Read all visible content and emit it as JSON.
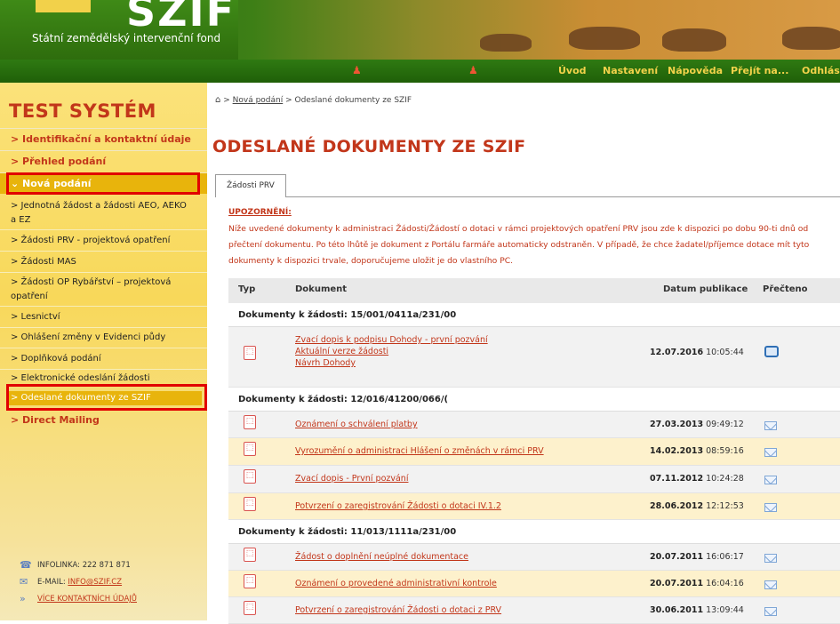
{
  "header": {
    "logo_text": "SZIF",
    "subtitle": "Státní zemědělský intervenční fond"
  },
  "nav": {
    "items": [
      "Úvod",
      "Nastavení",
      "Nápověda",
      "Přejít na...",
      "Odhlásit"
    ]
  },
  "sidebar": {
    "title": "TEST SYSTÉM",
    "main_items": [
      "> Identifikační a kontaktní údaje",
      "> Přehled podání",
      "⌄ Nová podání",
      "> Direct Mailing"
    ],
    "sub_items": [
      "> Jednotná žádost a žádosti AEO, AEKO a EZ",
      "> Žádosti PRV - projektová opatření",
      "> Žádosti MAS",
      "> Žádosti OP Rybářství – projektová opatření",
      "> Lesnictví",
      "> Ohlášení změny v Evidenci půdy",
      "> Doplňková podání",
      "> Elektronické odeslání žádosti",
      "> Odeslané dokumenty ze SZIF"
    ],
    "contact": {
      "phone": "INFOLINKA: 222 871 871",
      "email_label": "E-MAIL: ",
      "email": "INFO@SZIF.CZ",
      "more": "VÍCE KONTAKTNÍCH ÚDAJŮ"
    }
  },
  "breadcrumb": {
    "link": "Nová podání",
    "separator": " > ",
    "current": "Odeslané dokumenty ze SZIF"
  },
  "page_title": "ODESLANÉ DOKUMENTY ZE SZIF",
  "tab": "Žádosti PRV",
  "notice": {
    "title": "UPOZORNĚNÍ:",
    "text": "Níže uvedené dokumenty k administraci Žádosti/Žádostí o dotaci v rámci projektových opatření PRV jsou zde k dispozici po dobu 90-ti dnů od přečtení dokumentu. Po této lhůtě je dokument z Portálu farmáře automaticky odstraněn. V případě, že chce žadatel/příjemce dotace mít tyto dokumenty k dispozici trvale, doporučujeme uložit je do vlastního PC."
  },
  "table": {
    "headers": [
      "Typ",
      "Dokument",
      "Datum publikace",
      "Přečteno"
    ],
    "groups": [
      {
        "label": "Dokumenty k žádosti: 15/001/0411a/231/00",
        "rows": [
          {
            "docs": [
              "Zvací dopis k podpisu Dohody - první pozvání",
              "Aktuální verze žádosti",
              "Návrh Dohody"
            ],
            "date": "12.07.2016",
            "time": "10:05:44",
            "read": true
          }
        ]
      },
      {
        "label": "Dokumenty k žádosti: 12/016/41200/066/(",
        "rows": [
          {
            "docs": [
              "Oznámení o schválení platby"
            ],
            "date": "27.03.2013",
            "time": "09:49:12",
            "read": false
          },
          {
            "docs": [
              "Vyrozumění o administraci Hlášení o změnách v rámci PRV"
            ],
            "date": "14.02.2013",
            "time": "08:59:16",
            "read": false
          },
          {
            "docs": [
              "Zvací dopis - První pozvání"
            ],
            "date": "07.11.2012",
            "time": "10:24:28",
            "read": false
          },
          {
            "docs": [
              "Potvrzení o zaregistrování Žádosti o dotaci IV.1.2"
            ],
            "date": "28.06.2012",
            "time": "12:12:53",
            "read": false
          }
        ]
      },
      {
        "label": "Dokumenty k žádosti: 11/013/1111a/231/00",
        "rows": [
          {
            "docs": [
              "Žádost o doplnění neúplné dokumentace"
            ],
            "date": "20.07.2011",
            "time": "16:06:17",
            "read": false
          },
          {
            "docs": [
              "Oznámení o provedené administrativní kontrole"
            ],
            "date": "20.07.2011",
            "time": "16:04:16",
            "read": false
          },
          {
            "docs": [
              "Potvrzení o zaregistrování Žádosti o dotaci z PRV"
            ],
            "date": "30.06.2011",
            "time": "13:09:44",
            "read": false
          }
        ]
      }
    ]
  },
  "colors": {
    "brand_red": "#c2361a",
    "highlight_box": "#e10000",
    "sidebar_yellow": "#f8d85a",
    "nav_green": "#2f7a12",
    "nav_text": "#f2d24a"
  }
}
